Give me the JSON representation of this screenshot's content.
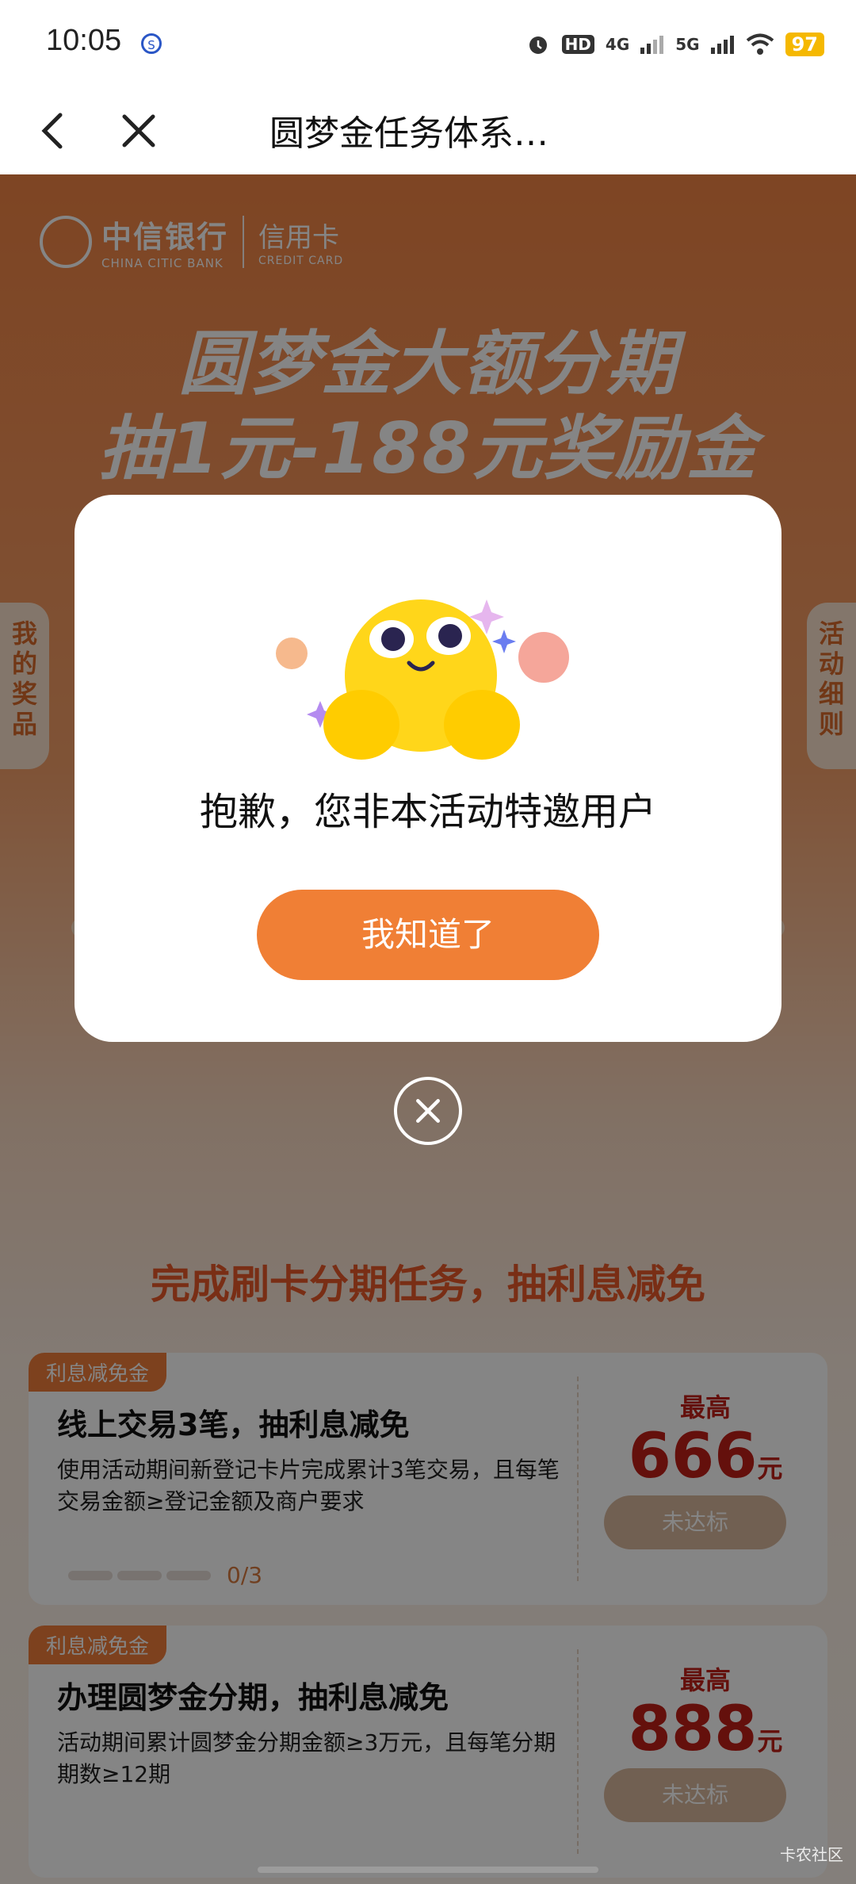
{
  "status_bar": {
    "time": "10:05",
    "icons": [
      "alarm-icon",
      "hd-icon",
      "4g-signal-icon",
      "5g-signal-icon",
      "wifi-icon"
    ],
    "net_4g": "4G",
    "net_5g": "5G",
    "battery": "97"
  },
  "nav": {
    "title": "圆梦金任务体系…"
  },
  "banner": {
    "brand_cn": "中信银行",
    "brand_en": "CHINA CITIC BANK",
    "card_cn": "信用卡",
    "card_en": "CREDIT CARD",
    "headline_1": "圆梦金大额分期",
    "headline_2": "抽1元-188元奖励金"
  },
  "side_tabs": {
    "left": "我的奖品",
    "right": "活动细则"
  },
  "section": {
    "title": "完成刷卡分期任务，抽利息减免"
  },
  "tasks": [
    {
      "tag": "利息减免金",
      "title": "线上交易3笔，抽利息减免",
      "desc": "使用活动期间新登记卡片完成累计3笔交易，且每笔交易金额≥登记金额及商户要求",
      "max_label": "最高",
      "amount": "666",
      "unit": "元",
      "button": "未达标",
      "progress": "0/3"
    },
    {
      "tag": "利息减免金",
      "title": "办理圆梦金分期，抽利息减免",
      "desc": "活动期间累计圆梦金分期金额≥3万元，且每笔分期期数≥12期",
      "max_label": "最高",
      "amount": "888",
      "unit": "元",
      "button": "未达标"
    }
  ],
  "modal": {
    "message": "抱歉，您非本活动特邀用户",
    "button": "我知道了"
  },
  "watermark": "卡农社区"
}
